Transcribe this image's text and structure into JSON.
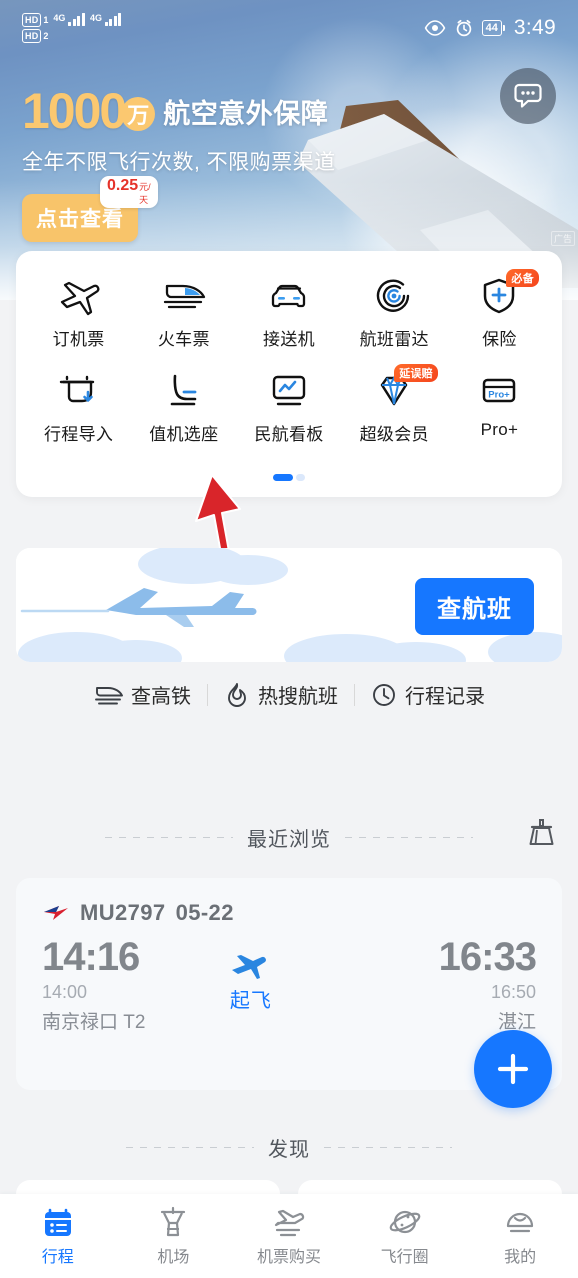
{
  "status_bar": {
    "hd_labels": [
      "HD",
      "HD"
    ],
    "network_1": "4G",
    "network_2": "4G",
    "eye_icon": "eye-icon",
    "alarm_icon": "alarm-clock-icon",
    "battery_level": "44",
    "time": "3:49"
  },
  "banner": {
    "chat_icon": "chat-bubble-icon",
    "amount": "1000",
    "unit": "万",
    "headline": "航空意外保障",
    "subline": "全年不限飞行次数, 不限购票渠道",
    "cta_label": "点击查看",
    "price_value": "0.25",
    "price_unit": "元/天",
    "ad_tag": "广告"
  },
  "grid": {
    "rows": [
      [
        {
          "label": "订机票",
          "icon": "airplane-takeoff-icon",
          "badge": ""
        },
        {
          "label": "火车票",
          "icon": "train-icon",
          "badge": ""
        },
        {
          "label": "接送机",
          "icon": "car-icon",
          "badge": ""
        },
        {
          "label": "航班雷达",
          "icon": "radar-icon",
          "badge": ""
        },
        {
          "label": "保险",
          "icon": "shield-plus-icon",
          "badge": "必备"
        }
      ],
      [
        {
          "label": "行程导入",
          "icon": "import-trip-icon",
          "badge": ""
        },
        {
          "label": "值机选座",
          "icon": "seat-icon",
          "badge": ""
        },
        {
          "label": "民航看板",
          "icon": "dashboard-chart-icon",
          "badge": ""
        },
        {
          "label": "超级会员",
          "icon": "diamond-icon",
          "badge": "延误赔"
        },
        {
          "label": "Pro+",
          "icon": "pro-card-icon",
          "badge": ""
        }
      ]
    ],
    "pager": {
      "total": 2,
      "active": 0
    }
  },
  "promo": {
    "button_label": "查航班",
    "plane_icon": "airplane-illustration"
  },
  "quick_links": [
    {
      "label": "查高铁",
      "icon": "train-icon"
    },
    {
      "label": "热搜航班",
      "icon": "fire-icon"
    },
    {
      "label": "行程记录",
      "icon": "clock-icon"
    }
  ],
  "recent": {
    "title": "最近浏览",
    "clear_icon": "broom-icon",
    "flight": {
      "airline_icon": "china-eastern-logo",
      "code": "MU2797",
      "date": "05-22",
      "depart_actual": "14:16",
      "depart_scheduled": "14:00",
      "depart_airport": "南京禄口 T2",
      "arrive_actual": "16:33",
      "arrive_scheduled": "16:50",
      "arrive_airport": "湛江",
      "status": "起飞",
      "status_icon": "airplane-icon"
    }
  },
  "discover": {
    "title": "发现"
  },
  "fab": {
    "icon": "plus-icon"
  },
  "bottom_nav": {
    "items": [
      {
        "label": "行程",
        "icon": "calendar-list-icon",
        "active": true
      },
      {
        "label": "机场",
        "icon": "control-tower-icon",
        "active": false
      },
      {
        "label": "机票购买",
        "icon": "airplane-ticket-icon",
        "active": false
      },
      {
        "label": "飞行圈",
        "icon": "planet-icon",
        "active": false
      },
      {
        "label": "我的",
        "icon": "profile-smile-icon",
        "active": false
      }
    ]
  },
  "colors": {
    "accent_blue": "#1677ff",
    "banner_gold": "#fbc870",
    "badge_red": "#f4451d",
    "annotation_red": "#d9252a"
  }
}
